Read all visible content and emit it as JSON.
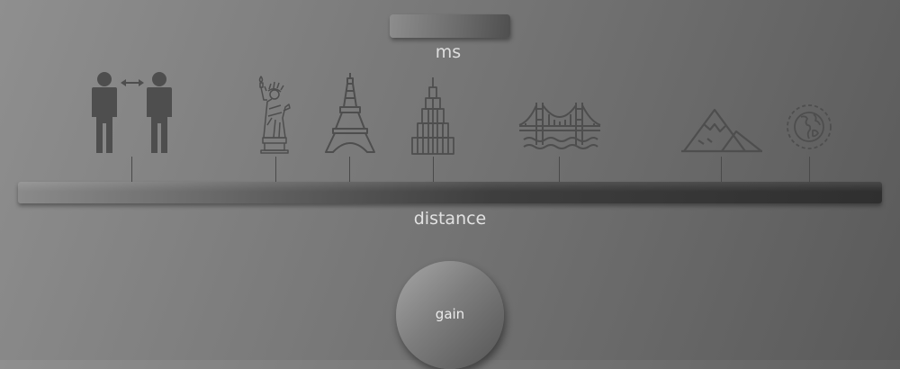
{
  "ms_slider": {
    "label": "ms"
  },
  "distance_slider": {
    "label": "distance",
    "markers": [
      {
        "name": "people-icon"
      },
      {
        "name": "statue-of-liberty-icon"
      },
      {
        "name": "eiffel-tower-icon"
      },
      {
        "name": "skyscraper-icon"
      },
      {
        "name": "bridge-icon"
      },
      {
        "name": "mountain-icon"
      },
      {
        "name": "globe-icon"
      }
    ]
  },
  "gain_knob": {
    "label": "gain"
  }
}
